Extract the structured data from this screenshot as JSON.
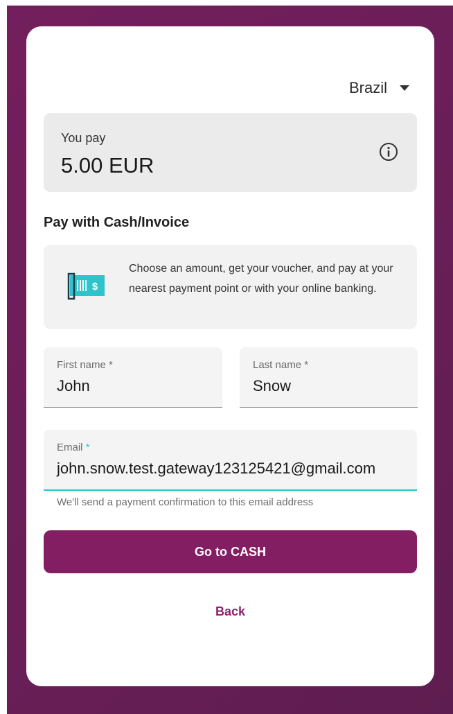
{
  "country_selector": {
    "value": "Brazil"
  },
  "summary": {
    "label": "You pay",
    "amount": "5.00 EUR"
  },
  "method": {
    "title": "Pay with Cash/Invoice",
    "description": "Choose an amount, get your voucher, and pay at your nearest payment point or with your online banking.",
    "icon": "voucher-icon"
  },
  "form": {
    "first_name": {
      "label": "First name",
      "required_mark": "*",
      "value": "John"
    },
    "last_name": {
      "label": "Last name",
      "required_mark": "*",
      "value": "Snow"
    },
    "email": {
      "label": "Email",
      "required_mark": "*",
      "value": "john.snow.test.gateway123125421@gmail.com",
      "helper": "We'll send a payment confirmation to this email address"
    }
  },
  "actions": {
    "primary": "Go to CASH",
    "back": "Back"
  },
  "colors": {
    "brand": "#831e63",
    "background": "#6a1e57",
    "focus": "#26c6d1",
    "icon_accent": "#2ec4cc"
  }
}
